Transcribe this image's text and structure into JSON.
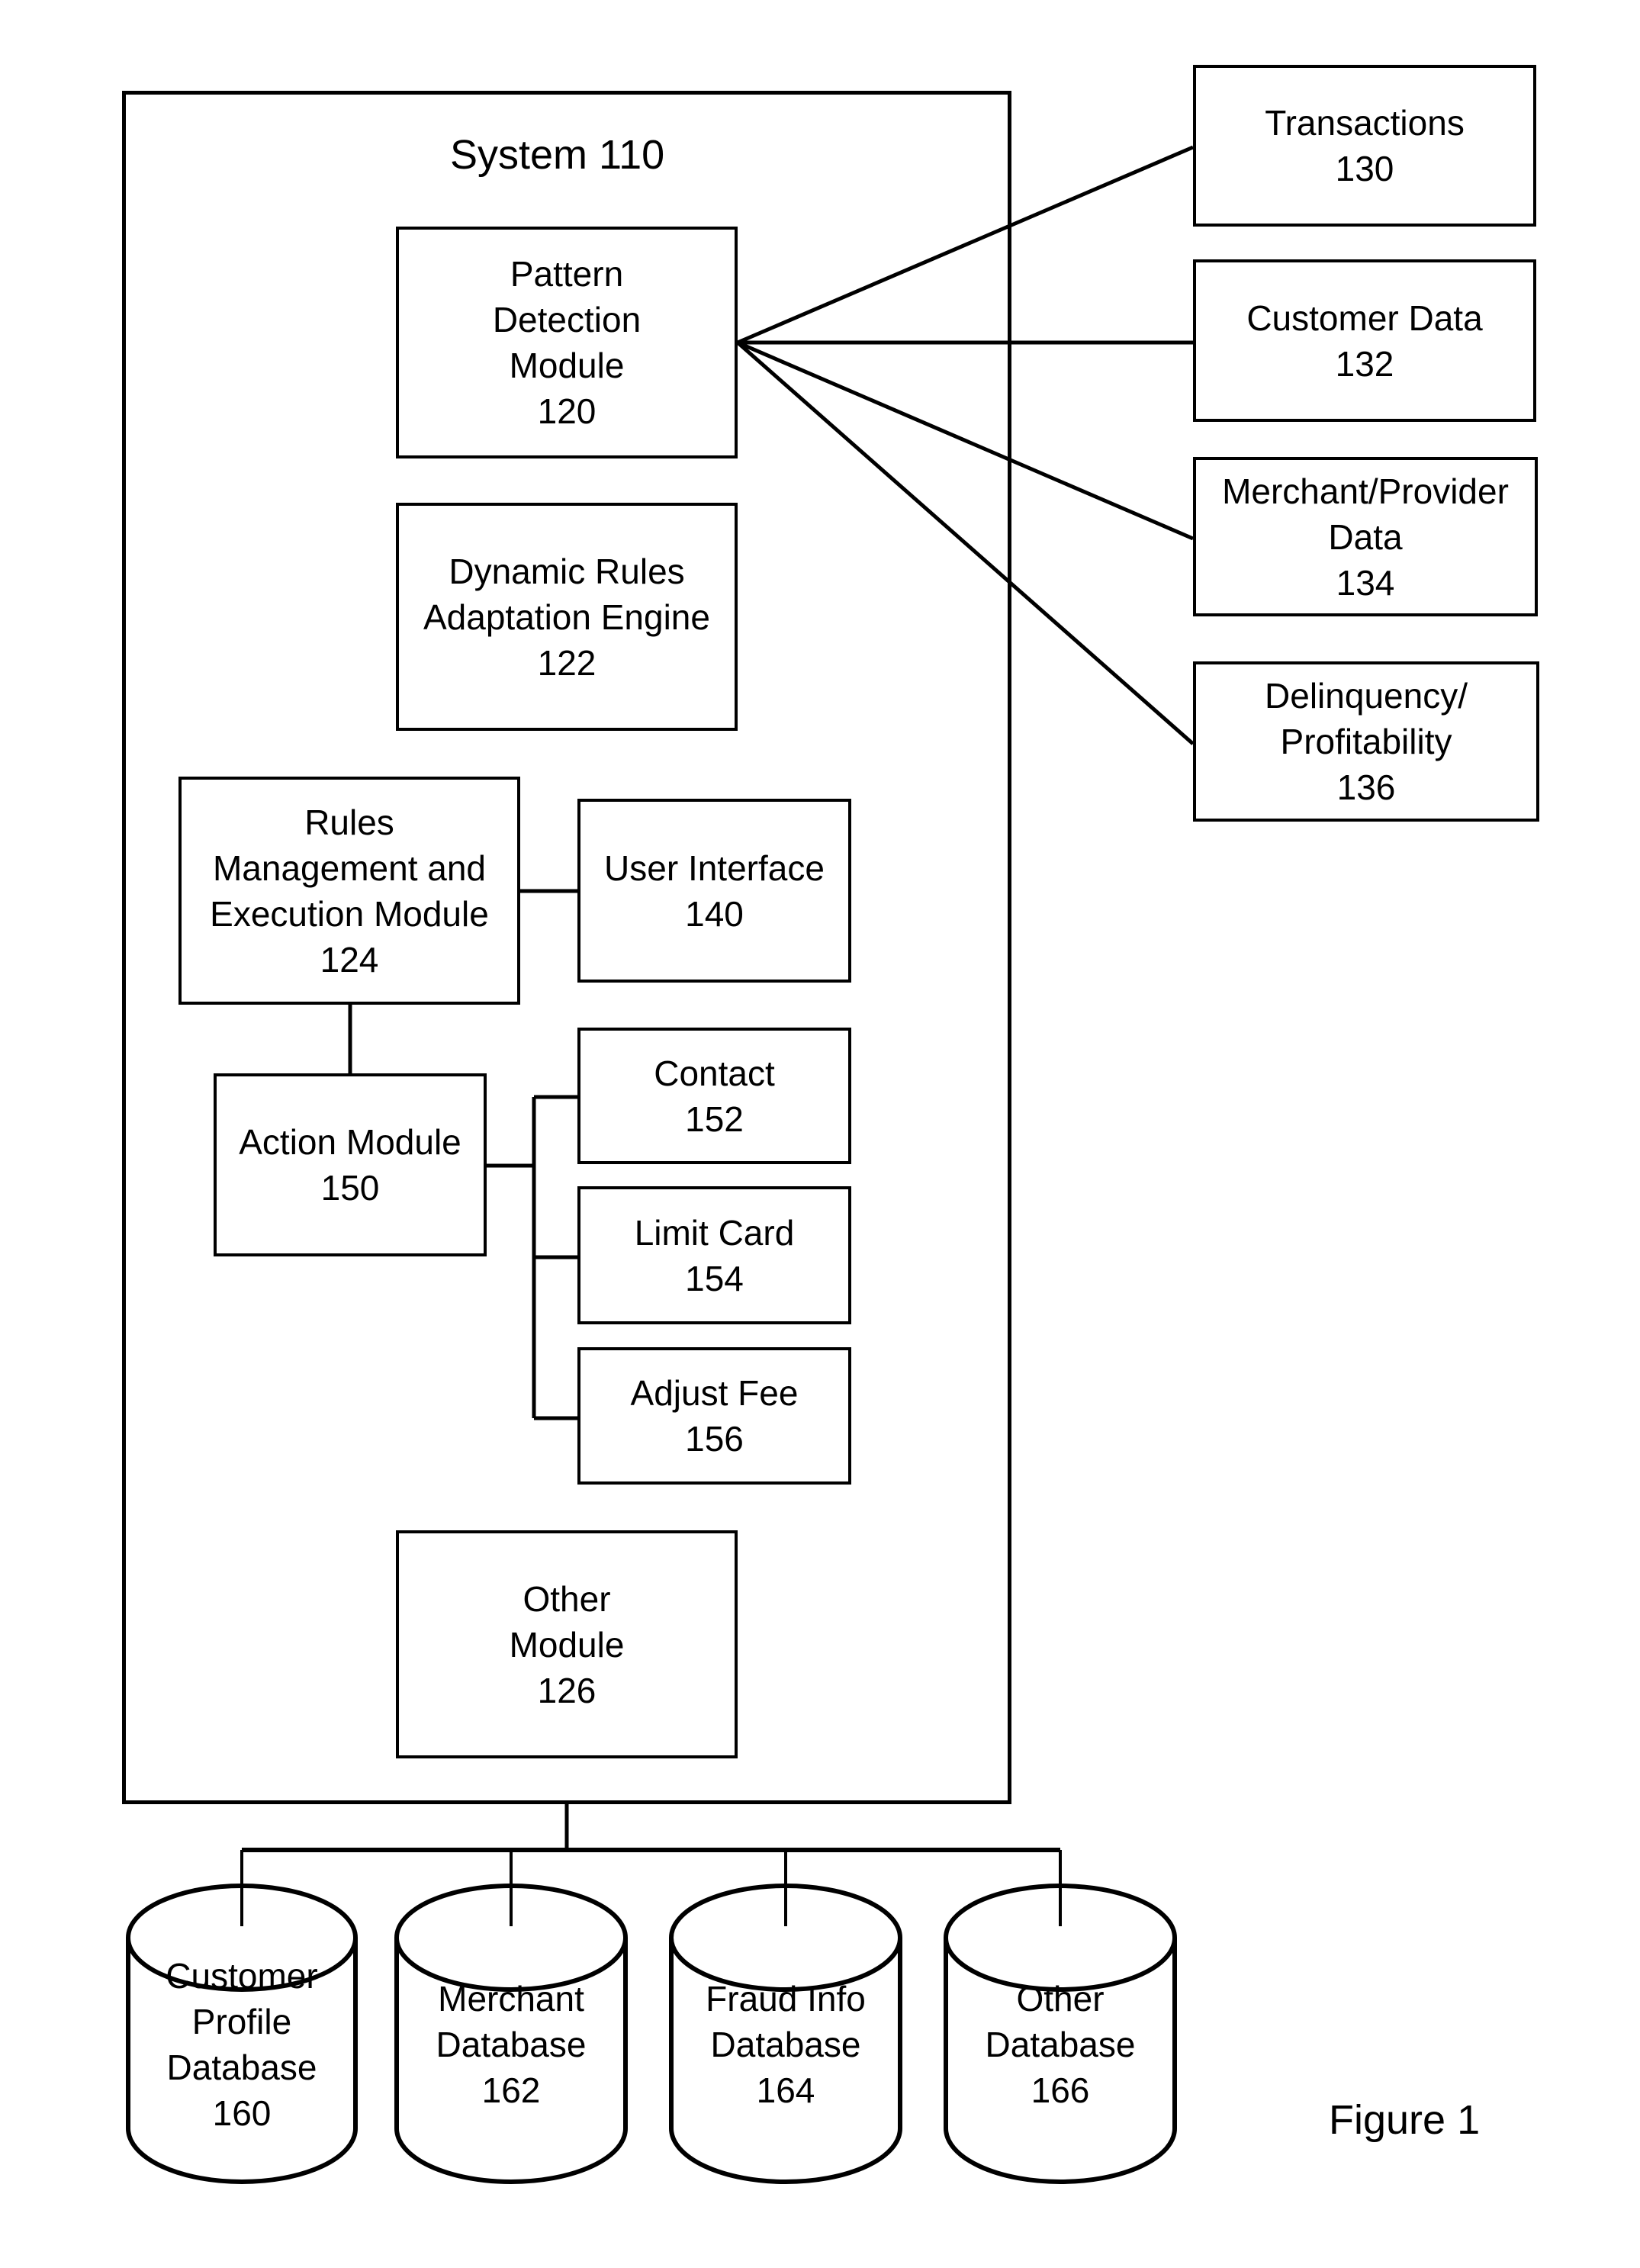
{
  "system": {
    "title": "System 110"
  },
  "modules": {
    "pattern": [
      "Pattern",
      "Detection",
      "Module",
      "120"
    ],
    "dynamic": [
      "Dynamic Rules",
      "Adaptation Engine",
      "122"
    ],
    "rules": [
      "Rules",
      "Management and",
      "Execution Module",
      "124"
    ],
    "ui": [
      "User Interface",
      "140"
    ],
    "action": [
      "Action Module",
      "150"
    ],
    "contact": [
      "Contact",
      "152"
    ],
    "limit": [
      "Limit Card",
      "154"
    ],
    "adjust": [
      "Adjust Fee",
      "156"
    ],
    "other": [
      "Other",
      "Module",
      "126"
    ]
  },
  "sources": {
    "transactions": [
      "Transactions",
      "130"
    ],
    "customer": [
      "Customer Data",
      "132"
    ],
    "merchant": [
      "Merchant/Provider",
      "Data",
      "134"
    ],
    "delinquency": [
      "Delinquency/",
      "Profitability",
      "136"
    ]
  },
  "databases": {
    "customer_profile": [
      "Customer",
      "Profile",
      "Database",
      "160"
    ],
    "merchant": [
      "Merchant",
      "Database",
      "162"
    ],
    "fraud": [
      "Fraud Info",
      "Database",
      "164"
    ],
    "other": [
      "Other",
      "Database",
      "166"
    ]
  },
  "figure_label": "Figure 1"
}
